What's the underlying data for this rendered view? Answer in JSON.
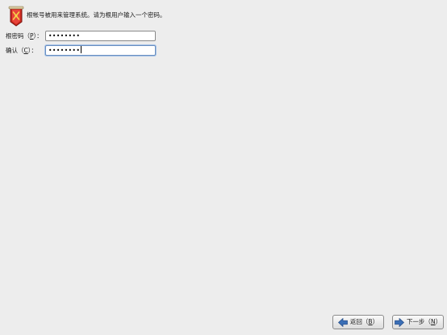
{
  "header": {
    "icon": "root-keys-icon",
    "message": "根帐号被用来管理系统。请为根用户输入一个密码。"
  },
  "fields": {
    "root_password": {
      "label_pre": "根密码（",
      "mnemonic": "P",
      "label_post": "）：",
      "value": "••••••••"
    },
    "confirm": {
      "label_pre": "确认（",
      "mnemonic": "C",
      "label_post": "）：",
      "value": "••••••••"
    }
  },
  "buttons": {
    "back": {
      "pre": "返回（",
      "mnemonic": "B",
      "post": "）",
      "icon": "arrow-left-icon"
    },
    "next": {
      "pre": "下一步（",
      "mnemonic": "N",
      "post": "）",
      "icon": "arrow-right-icon"
    }
  },
  "colors": {
    "background": "#ededed",
    "arrow": "#3b6fb6"
  }
}
